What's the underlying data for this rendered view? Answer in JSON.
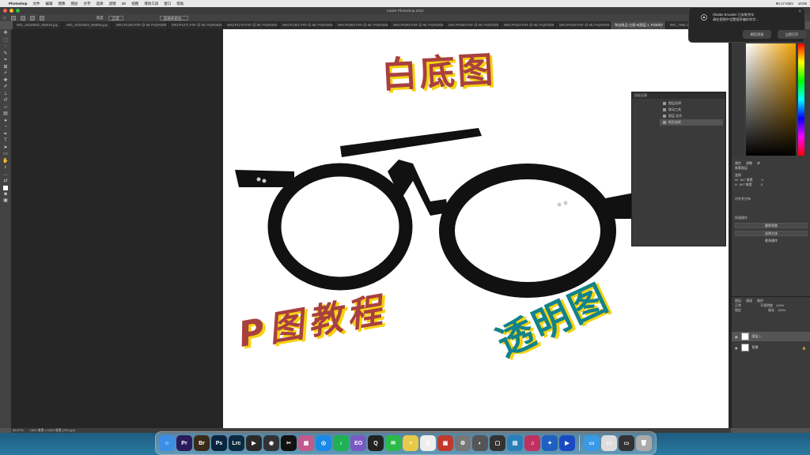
{
  "app": {
    "menu_app_name": "Photoshop",
    "menus": [
      "文件",
      "编辑",
      "图像",
      "图层",
      "文字",
      "选择",
      "滤镜",
      "3D",
      "视图",
      "增效工具",
      "窗口",
      "帮助"
    ],
    "window_title": "Adobe Photoshop 2022",
    "menu_status": [
      "90.17 KB/s",
      "10:06"
    ]
  },
  "options": {
    "style_label": "宽度",
    "style_value": "正常",
    "select_subject_button": "选择并遮住..."
  },
  "tabs": [
    {
      "label": "IMG_20220502_084516.jpg",
      "active": false
    },
    {
      "label": "IMG_20220503_084554.jpg",
      "active": false
    },
    {
      "label": "WKCP1302.PSF @ 66.7%(RGB/8",
      "active": false
    },
    {
      "label": "WKCP1271.PSF @ 66.7%(RGB/8",
      "active": false
    },
    {
      "label": "WKCP1276.PSF @ 66.7%(RGB/8",
      "active": false
    },
    {
      "label": "WKCP1301.PSF @ 66.7%(RGB/8",
      "active": false
    },
    {
      "label": "WKCP0304.PSF @ 66.7%(RGB/8",
      "active": false
    },
    {
      "label": "WKCP0492.PSF @ 66.7%(RGB/8",
      "active": false
    },
    {
      "label": "WKCP0466.PSF @ 66.7%(RGB/8",
      "active": false
    },
    {
      "label": "WKCP0433.PSF @ 66.7%(RGB/8",
      "active": false
    },
    {
      "label": "WKCP0428.PSF @ 66.7%(RGB/8",
      "active": false
    },
    {
      "label": "淘宝商品-主图-9(图层 1, RGB/8)*",
      "active": true
    },
    {
      "label": "IMG_7805.JPG",
      "active": false
    }
  ],
  "canvas": {
    "title_text": "白底图",
    "tutorial_text": "P图教程",
    "transparent_text": "透明图",
    "title_color": "#a84040",
    "transparent_color": "#13828a",
    "shadow_color": "#f5d20e"
  },
  "history_panel": {
    "header": "历史记录",
    "items": [
      "图层选择",
      "移动工具",
      "图层 混合",
      "矩形选框"
    ]
  },
  "properties": {
    "tabs": [
      "属性",
      "调整",
      "库"
    ],
    "type_label": "像素图层",
    "transform_label": "变换",
    "w_label": "W",
    "w_value": "847 像素",
    "h_label": "H",
    "h_value": "847 像素",
    "x_value": "0",
    "y_value": "0",
    "align_label": "对齐并分布",
    "quick_actions_label": "快速操作",
    "actions": [
      "删除背景",
      "选择主体",
      "更多操作"
    ]
  },
  "layers": {
    "tabs": [
      "图层",
      "通道",
      "路径"
    ],
    "blend_mode": "正常",
    "opacity_label": "不透明度",
    "opacity": "100%",
    "lock_label": "锁定",
    "fill_label": "填充",
    "fill": "100%",
    "items": [
      {
        "name": "图层 1",
        "selected": true
      },
      {
        "name": "背景",
        "selected": false
      }
    ]
  },
  "notification": {
    "line1": "Shutter Encoder 已安装完毕",
    "line2": "请在视频中设置程序偏好的字...",
    "button_later": "稍后再说",
    "button_open": "立即打开"
  },
  "status": {
    "zoom": "66.67%",
    "doc_size": "1500 像素 x 1500 像素 (300 ppi)"
  },
  "dock": [
    {
      "name": "finder",
      "label": "☺",
      "color": "#3d8fe6"
    },
    {
      "name": "premiere",
      "label": "Pr",
      "color": "#2a1a5e"
    },
    {
      "name": "bridge",
      "label": "Br",
      "color": "#3a2a1a"
    },
    {
      "name": "photoshop",
      "label": "Ps",
      "color": "#0a2540"
    },
    {
      "name": "lightroom",
      "label": "Lrc",
      "color": "#0b2a3f"
    },
    {
      "name": "final-cut",
      "label": "▶",
      "color": "#2a2a2a"
    },
    {
      "name": "davinci",
      "label": "◉",
      "color": "#333"
    },
    {
      "name": "capcut",
      "label": "✂",
      "color": "#111"
    },
    {
      "name": "launchpad",
      "label": "▦",
      "color": "#c25a8e"
    },
    {
      "name": "safari",
      "label": "◎",
      "color": "#1a8ae6"
    },
    {
      "name": "qq-music",
      "label": "♪",
      "color": "#1fb154"
    },
    {
      "name": "eudic",
      "label": "EO",
      "color": "#7a5ac2"
    },
    {
      "name": "qq",
      "label": "Q",
      "color": "#222"
    },
    {
      "name": "wechat",
      "label": "✉",
      "color": "#2bbb4a"
    },
    {
      "name": "notes",
      "label": "≡",
      "color": "#e8c94a"
    },
    {
      "name": "reminders",
      "label": "☰",
      "color": "#eee"
    },
    {
      "name": "photo-booth",
      "label": "▣",
      "color": "#c0392b"
    },
    {
      "name": "system-prefs",
      "label": "⚙",
      "color": "#777"
    },
    {
      "name": "vpn",
      "label": "◐",
      "color": "#555"
    },
    {
      "name": "screenshot",
      "label": "▢",
      "color": "#333"
    },
    {
      "name": "office",
      "label": "▤",
      "color": "#2980b9"
    },
    {
      "name": "music-app",
      "label": "♫",
      "color": "#c03060"
    },
    {
      "name": "xmind",
      "label": "✦",
      "color": "#2060c0"
    },
    {
      "name": "video",
      "label": "▶",
      "color": "#1a4ac2"
    },
    {
      "name": "folder-1",
      "label": "▭",
      "color": "#3a9ae6"
    },
    {
      "name": "folder-2",
      "label": "▭",
      "color": "#ddd"
    },
    {
      "name": "screen-rec",
      "label": "▭",
      "color": "#333"
    },
    {
      "name": "trash",
      "label": "🗑",
      "color": "#aaa"
    }
  ]
}
